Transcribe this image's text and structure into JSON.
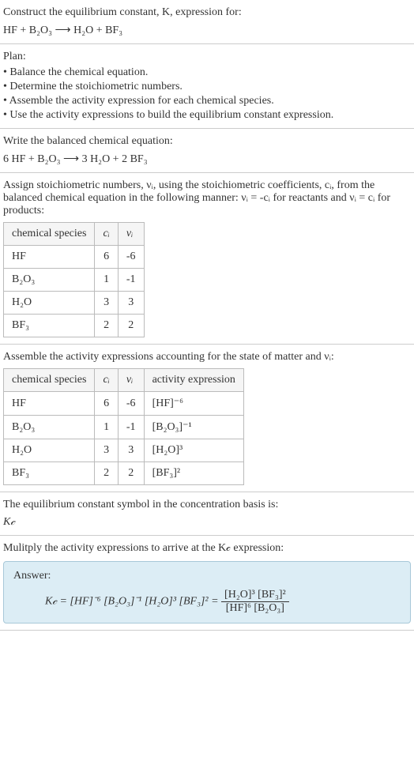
{
  "header": {
    "prompt": "Construct the equilibrium constant, K, expression for:",
    "equation_lhs": "HF + B₂O₃",
    "arrow": "⟶",
    "equation_rhs": "H₂O + BF₃"
  },
  "plan": {
    "title": "Plan:",
    "items": [
      "• Balance the chemical equation.",
      "• Determine the stoichiometric numbers.",
      "• Assemble the activity expression for each chemical species.",
      "• Use the activity expressions to build the equilibrium constant expression."
    ]
  },
  "balanced": {
    "prompt": "Write the balanced chemical equation:",
    "equation": "6 HF + B₂O₃ ⟶ 3 H₂O + 2 BF₃"
  },
  "stoich": {
    "prompt_a": "Assign stoichiometric numbers, νᵢ, using the stoichiometric coefficients, cᵢ, from the balanced chemical equation in the following manner: νᵢ = -cᵢ for reactants and νᵢ = cᵢ for products:",
    "headers": {
      "h1": "chemical species",
      "h2": "cᵢ",
      "h3": "νᵢ"
    },
    "rows": [
      {
        "species": "HF",
        "c": "6",
        "nu": "-6"
      },
      {
        "species": "B₂O₃",
        "c": "1",
        "nu": "-1"
      },
      {
        "species": "H₂O",
        "c": "3",
        "nu": "3"
      },
      {
        "species": "BF₃",
        "c": "2",
        "nu": "2"
      }
    ]
  },
  "activity": {
    "prompt": "Assemble the activity expressions accounting for the state of matter and νᵢ:",
    "headers": {
      "h1": "chemical species",
      "h2": "cᵢ",
      "h3": "νᵢ",
      "h4": "activity expression"
    },
    "rows": [
      {
        "species": "HF",
        "c": "6",
        "nu": "-6",
        "expr": "[HF]⁻⁶"
      },
      {
        "species": "B₂O₃",
        "c": "1",
        "nu": "-1",
        "expr": "[B₂O₃]⁻¹"
      },
      {
        "species": "H₂O",
        "c": "3",
        "nu": "3",
        "expr": "[H₂O]³"
      },
      {
        "species": "BF₃",
        "c": "2",
        "nu": "2",
        "expr": "[BF₃]²"
      }
    ]
  },
  "symbol": {
    "prompt": "The equilibrium constant symbol in the concentration basis is:",
    "value": "K𝒸"
  },
  "multiply": {
    "prompt": "Mulitply the activity expressions to arrive at the K𝒸 expression:"
  },
  "answer": {
    "label": "Answer:",
    "lhs": "K𝒸 = [HF]⁻⁶ [B₂O₃]⁻¹ [H₂O]³ [BF₃]² = ",
    "frac_top": "[H₂O]³ [BF₃]²",
    "frac_bot": "[HF]⁶ [B₂O₃]"
  }
}
